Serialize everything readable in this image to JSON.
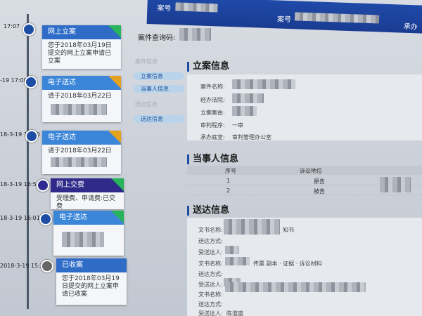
{
  "topbar": {
    "case_label_1": "案号",
    "case_label_2": "案号",
    "right_label": "承办"
  },
  "timeline": [
    {
      "time": "17:07",
      "type": "网上立案",
      "text": "您于2018年03月19日提交的网上立案申请已立案",
      "badge": "green"
    },
    {
      "time": "-19 17:00",
      "type": "电子送达",
      "text": "请于2018年03月22日",
      "badge": "yellow"
    },
    {
      "time": "18-3-19 17:00",
      "type": "电子送达",
      "text": "请于2018年03月22日",
      "badge": "yellow"
    },
    {
      "time": "18-3-19 16:54",
      "type": "网上交费",
      "text": "受理费、申请费:已交费",
      "badge": "green"
    },
    {
      "time": "18-3-19 16:01",
      "type": "电子送达",
      "text": "",
      "badge": "green"
    },
    {
      "time": "2018-3-19 15:29",
      "type": "已收案",
      "text": "您于2018年03月19日提交的网上立案申请已收案",
      "badge": "none"
    }
  ],
  "query": {
    "label": "案件查询码:"
  },
  "sidenav": [
    {
      "label": "案件信息",
      "state": "dim"
    },
    {
      "label": "立案信息",
      "state": "active"
    },
    {
      "label": "当事人信息",
      "state": "active"
    },
    {
      "label": "送达信息",
      "state": "dim"
    },
    {
      "label": "送达信息",
      "state": "active"
    }
  ],
  "filing": {
    "title": "立案信息",
    "fields": [
      {
        "label": "案件名称:"
      },
      {
        "label": "经办法院:"
      },
      {
        "label": "立案案由:"
      },
      {
        "label": "审判程序:",
        "value": "一审"
      },
      {
        "label": "承办庭室:",
        "value": "审判管理办公室"
      }
    ]
  },
  "parties": {
    "title": "当事人信息",
    "headers": [
      "序号",
      "诉讼地位"
    ],
    "rows": [
      {
        "no": "1",
        "role": "原告"
      },
      {
        "no": "2",
        "role": "被告"
      }
    ]
  },
  "delivery": {
    "title": "送达信息",
    "fields": [
      {
        "label": "文书名称:",
        "value": "知书"
      },
      {
        "label": "送达方式:"
      },
      {
        "label": "受送达人:"
      },
      {
        "label": "文书名称:",
        "value": "传票 副本 · 证据 · 诉讼材料"
      },
      {
        "label": "送达方式:"
      },
      {
        "label": "受送达人:"
      },
      {
        "label": "文书名称:"
      },
      {
        "label": "送达方式:"
      },
      {
        "label": "受送达人:",
        "value": "陈道盛"
      }
    ]
  }
}
